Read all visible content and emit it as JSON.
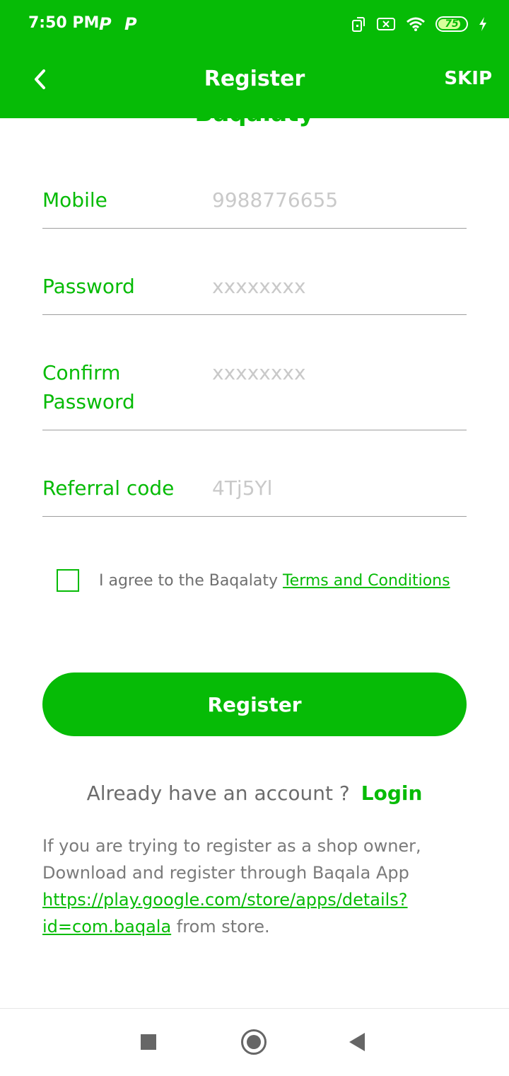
{
  "status_bar": {
    "time": "7:50 PM",
    "battery": "75"
  },
  "header": {
    "title": "Register",
    "skip_label": "SKIP"
  },
  "hidden_title_peek": "Baqalaty",
  "form": {
    "mobile": {
      "label": "Mobile",
      "placeholder": "9988776655"
    },
    "password": {
      "label": "Password",
      "placeholder": "xxxxxxxx"
    },
    "confirm_password": {
      "label_line1": "Confirm",
      "label_line2": "Password",
      "placeholder": "xxxxxxxx"
    },
    "referral": {
      "label": "Referral code",
      "placeholder": "4Tj5Yl"
    }
  },
  "agreement": {
    "text": "I agree to the Baqalaty ",
    "link": "Terms and Conditions"
  },
  "register_button": "Register",
  "login_row": {
    "text": "Already have an account ?",
    "link": "Login"
  },
  "info": {
    "line1": "If you are trying to register as a shop owner,",
    "line2": "Download and register through Baqala App",
    "link": "https://play.google.com/store/apps/details?id=com.baqala",
    "suffix": " from store."
  },
  "colors": {
    "brand": "#06bb06"
  }
}
